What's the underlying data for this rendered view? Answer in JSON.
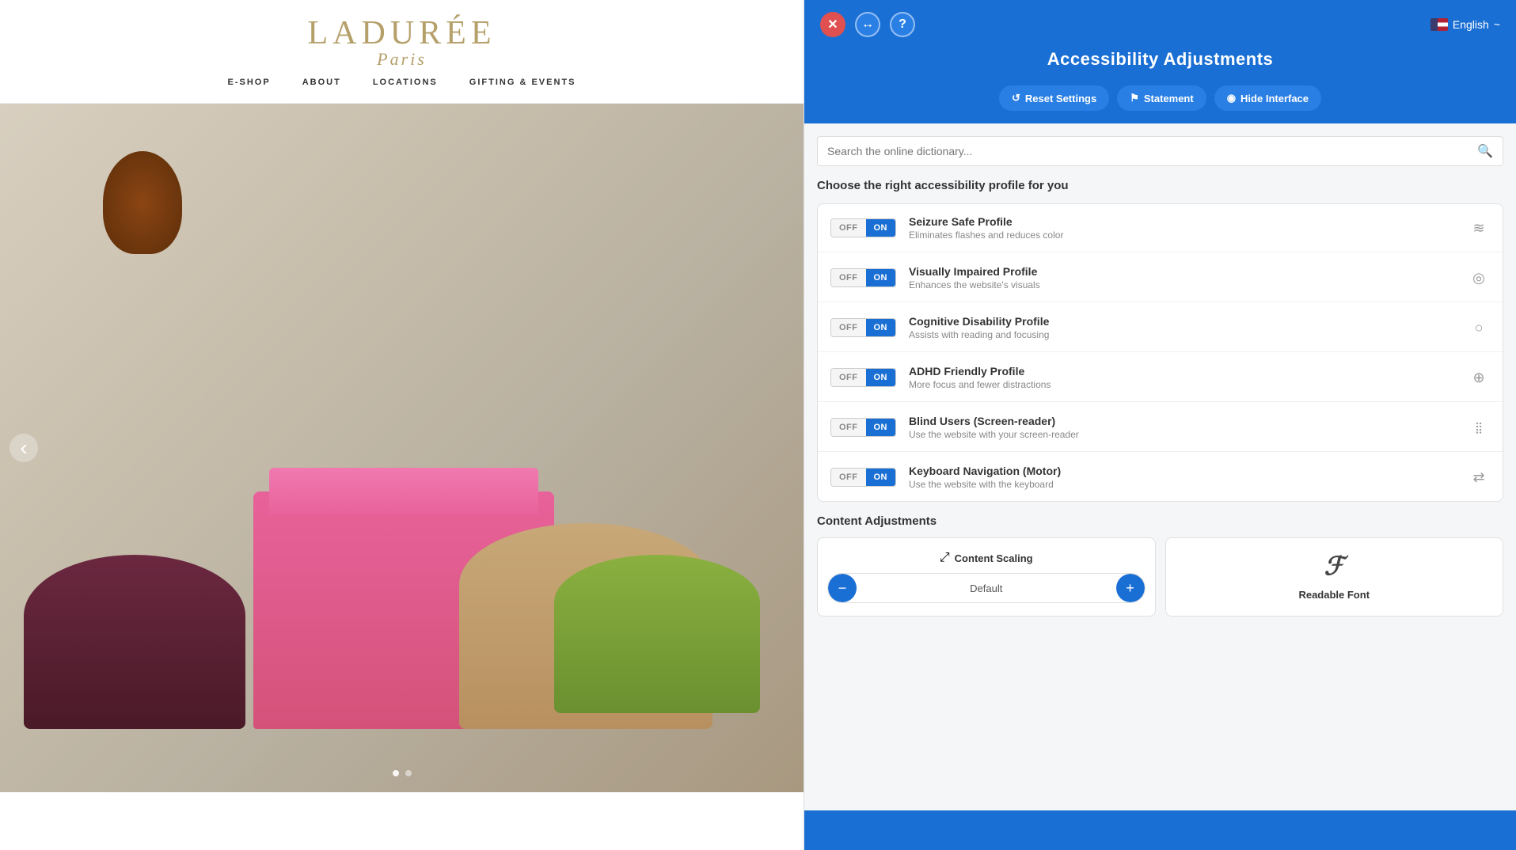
{
  "website": {
    "logo": "LADURÉE",
    "logo_sub": "Paris",
    "nav": {
      "items": [
        {
          "label": "E-SHOP"
        },
        {
          "label": "ABOUT"
        },
        {
          "label": "LOCATIONS"
        },
        {
          "label": "GIFTING & EVENTS"
        }
      ]
    }
  },
  "panel": {
    "title": "Accessibility Adjustments",
    "header": {
      "close_label": "✕",
      "back_label": "↔",
      "help_label": "?",
      "lang_label": "English",
      "lang_caret": "~"
    },
    "actions": {
      "reset_label": "Reset Settings",
      "statement_label": "Statement",
      "hide_label": "Hide Interface"
    },
    "search": {
      "placeholder": "Search the online dictionary..."
    },
    "profiles_title": "Choose the right accessibility profile for you",
    "profiles": [
      {
        "name": "Seizure Safe Profile",
        "desc": "Eliminates flashes and reduces color",
        "icon": "≋",
        "off": "OFF",
        "on": "ON"
      },
      {
        "name": "Visually Impaired Profile",
        "desc": "Enhances the website's visuals",
        "icon": "◎",
        "off": "OFF",
        "on": "ON"
      },
      {
        "name": "Cognitive Disability Profile",
        "desc": "Assists with reading and focusing",
        "icon": "○",
        "off": "OFF",
        "on": "ON"
      },
      {
        "name": "ADHD Friendly Profile",
        "desc": "More focus and fewer distractions",
        "icon": "⊕",
        "off": "OFF",
        "on": "ON"
      },
      {
        "name": "Blind Users (Screen-reader)",
        "desc": "Use the website with your screen-reader",
        "icon": "⣿",
        "off": "OFF",
        "on": "ON"
      },
      {
        "name": "Keyboard Navigation (Motor)",
        "desc": "Use the website with the keyboard",
        "icon": "⇄",
        "off": "OFF",
        "on": "ON"
      }
    ],
    "content_adjustments": {
      "title": "Content Adjustments",
      "scaling": {
        "label": "Content Scaling",
        "icon": "⤢",
        "value": "Default",
        "dec_label": "−",
        "inc_label": "+"
      },
      "font": {
        "label": "Readable Font",
        "icon": "𝓕"
      }
    }
  }
}
